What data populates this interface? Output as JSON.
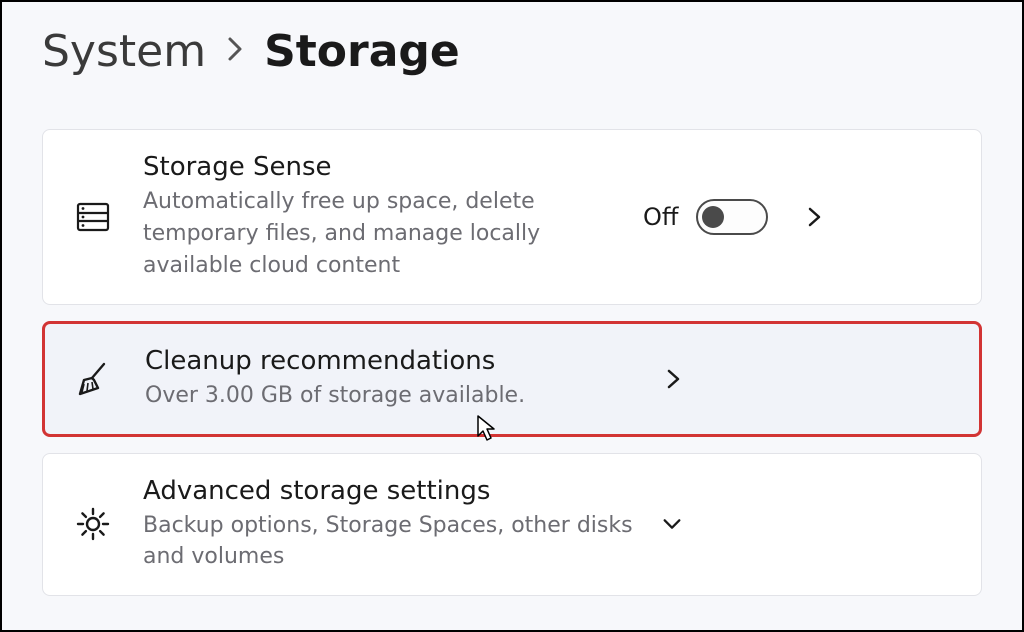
{
  "breadcrumb": {
    "parent": "System",
    "current": "Storage"
  },
  "cards": {
    "storage_sense": {
      "title": "Storage Sense",
      "description": "Automatically free up space, delete temporary files, and manage locally available cloud content",
      "toggle_state_label": "Off",
      "toggle_on": false
    },
    "cleanup": {
      "title": "Cleanup recommendations",
      "description": "Over 3.00 GB of storage available."
    },
    "advanced": {
      "title": "Advanced storage settings",
      "description": "Backup options, Storage Spaces, other disks and volumes"
    }
  }
}
